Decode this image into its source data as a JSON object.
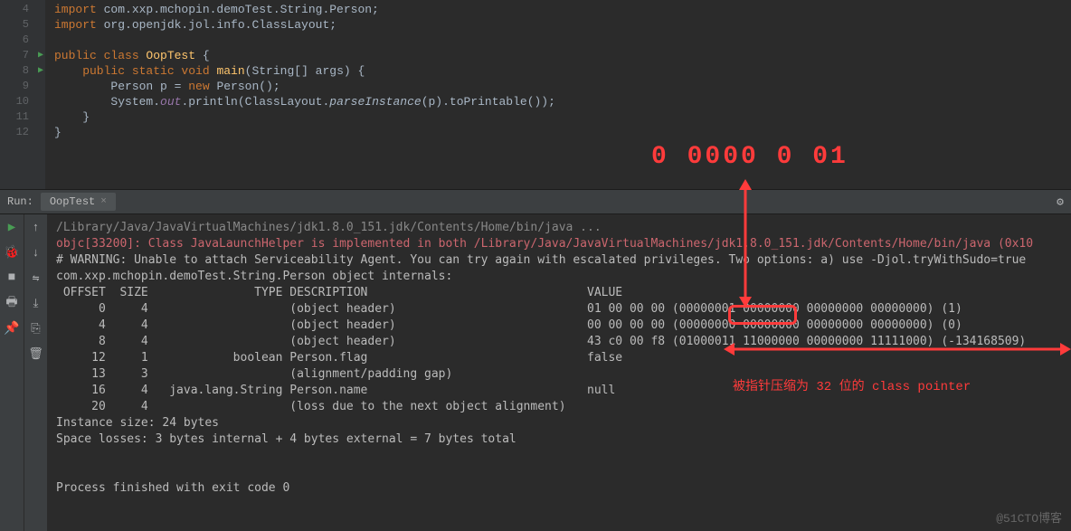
{
  "lines": {
    "n4": "4",
    "n5": "5",
    "n6": "6",
    "n7": "7",
    "n8": "8",
    "n9": "9",
    "n10": "10",
    "n11": "11",
    "n12": "12"
  },
  "code": {
    "l4_a": "import",
    "l4_b": " com.xxp.mchopin.demoTest.String.Person;",
    "l5_a": "import",
    "l5_b": " org.openjdk.jol.info.ClassLayout;",
    "l7_a": "public class ",
    "l7_b": "OopTest",
    "l7_c": " {",
    "l8_a": "    public static void ",
    "l8_b": "main",
    "l8_c": "(String[] args) {",
    "l9_a": "        Person p = ",
    "l9_b": "new",
    "l9_c": " Person();",
    "l10_a": "        System.",
    "l10_b": "out",
    "l10_c": ".println(ClassLayout.",
    "l10_d": "parseInstance",
    "l10_e": "(p).toPrintable());",
    "l11": "    }",
    "l12": "}"
  },
  "overlay": {
    "bits": "0  0000  0  01",
    "label": "被指针压缩为 32 位的 class pointer"
  },
  "run": {
    "label": "Run:",
    "tab": "OopTest",
    "close": "×"
  },
  "console": {
    "l1": "/Library/Java/JavaVirtualMachines/jdk1.8.0_151.jdk/Contents/Home/bin/java ...",
    "l2": "objc[33200]: Class JavaLaunchHelper is implemented in both /Library/Java/JavaVirtualMachines/jdk1.8.0_151.jdk/Contents/Home/bin/java (0x10",
    "l3": "# WARNING: Unable to attach Serviceability Agent. You can try again with escalated privileges. Two options: a) use -Djol.tryWithSudo=true",
    "l4": "com.xxp.mchopin.demoTest.String.Person object internals:",
    "l5": " OFFSET  SIZE               TYPE DESCRIPTION                               VALUE",
    "l6": "      0     4                    (object header)                           01 00 00 00 (00000001 00000000 00000000 00000000) (1)",
    "l7": "      4     4                    (object header)                           00 00 00 00 (00000000 00000000 00000000 00000000) (0)",
    "l8": "      8     4                    (object header)                           43 c0 00 f8 (01000011 11000000 00000000 11111000) (-134168509)",
    "l9": "     12     1            boolean Person.flag                               false",
    "l10": "     13     3                    (alignment/padding gap)                  ",
    "l11": "     16     4   java.lang.String Person.name                               null",
    "l12": "     20     4                    (loss due to the next object alignment)",
    "l13": "Instance size: 24 bytes",
    "l14": "Space losses: 3 bytes internal + 4 bytes external = 7 bytes total",
    "l15": "",
    "l16": "",
    "l17": "Process finished with exit code 0"
  },
  "watermark": "@51CTO博客"
}
